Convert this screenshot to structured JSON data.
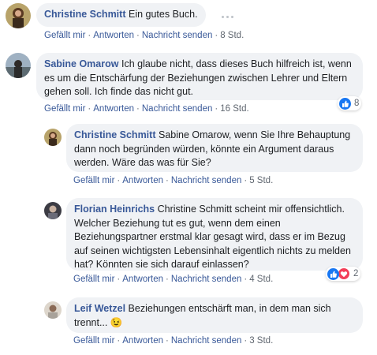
{
  "comments": [
    {
      "author": "Christine Schmitt",
      "text": "Ein gutes Buch.",
      "actions": {
        "like": "Gefällt mir",
        "reply": "Antworten",
        "message": "Nachricht senden",
        "time": "8 Std."
      }
    },
    {
      "author": "Sabine Omarow",
      "text": "Ich glaube nicht, dass dieses Buch hilfreich ist, wenn es um die Entschärfung der Beziehungen zwischen Lehrer und Eltern gehen soll. Ich finde das nicht gut.",
      "actions": {
        "like": "Gefällt mir",
        "reply": "Antworten",
        "message": "Nachricht senden",
        "time": "16 Std."
      },
      "reactions": {
        "count": "8",
        "icons": [
          "like-icon"
        ]
      }
    }
  ],
  "replies": [
    {
      "author": "Christine Schmitt",
      "text": "Sabine Omarow, wenn Sie Ihre Behauptung dann noch begründen würden, könnte ein Argument daraus werden. Wäre das was für Sie?",
      "actions": {
        "like": "Gefällt mir",
        "reply": "Antworten",
        "message": "Nachricht senden",
        "time": "5 Std."
      }
    },
    {
      "author": "Florian Heinrichs",
      "text": "Christine Schmitt scheint mir offensichtlich. Welcher Beziehung tut es gut, wenn dem einen Beziehungspartner erstmal klar gesagt wird, dass er im Bezug auf seinen wichtigsten Lebensinhalt eigentlich nichts zu melden hat? Könnten sie sich darauf einlassen?",
      "actions": {
        "like": "Gefällt mir",
        "reply": "Antworten",
        "message": "Nachricht senden",
        "time": "4 Std."
      },
      "reactions": {
        "count": "2",
        "icons": [
          "like-icon",
          "love-icon"
        ]
      }
    },
    {
      "author": "Leif Wetzel",
      "text": "Beziehungen entschärft man, in dem man sich trennt...",
      "emoji": "😉",
      "actions": {
        "like": "Gefällt mir",
        "reply": "Antworten",
        "message": "Nachricht senden",
        "time": "3 Std."
      }
    }
  ],
  "colors": {
    "link": "#385898",
    "bubble": "#f0f2f5",
    "like": "#1877f2",
    "love": "#f33e58"
  }
}
